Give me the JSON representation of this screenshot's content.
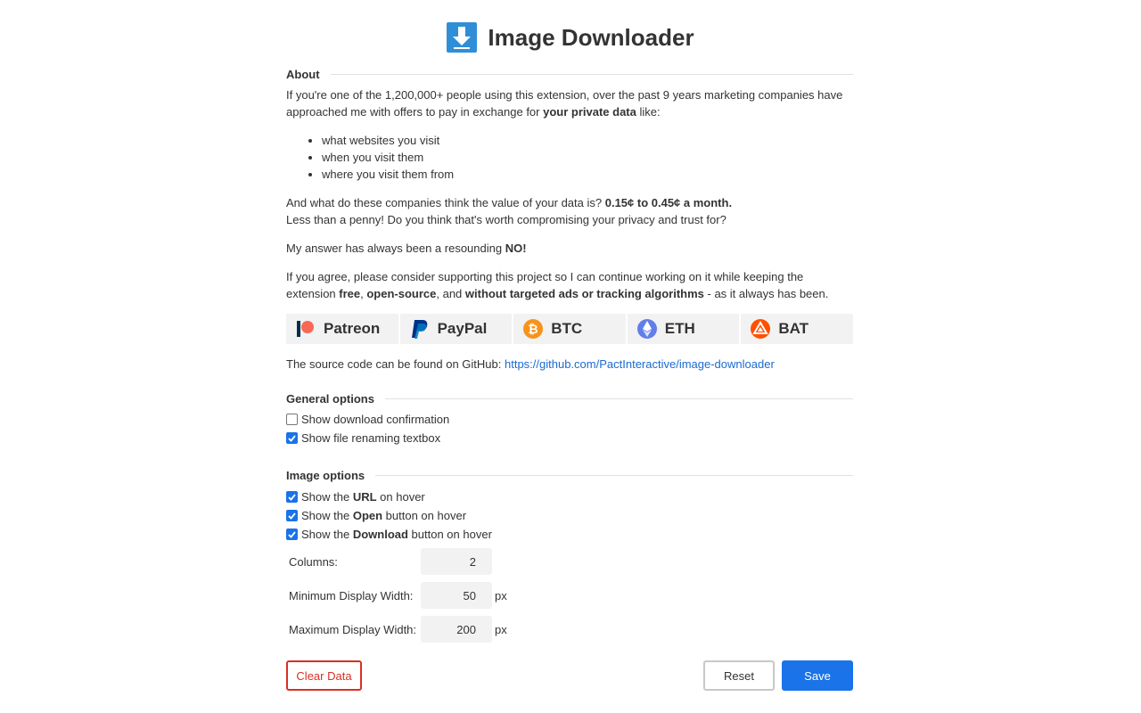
{
  "header": {
    "title": "Image Downloader",
    "logo_icon": "download-arrow-icon"
  },
  "about": {
    "heading": "About",
    "p1_pre": "If you're one of the 1,200,000+ people using this extension, over the past 9 years marketing companies have approached me with offers to pay in exchange for ",
    "p1_bold": "your private data",
    "p1_post": " like:",
    "list": [
      "what websites you visit",
      "when you visit them",
      "where you visit them from"
    ],
    "p2_pre": "And what do these companies think the value of your data is? ",
    "p2_bold": "0.15¢ to 0.45¢ a month.",
    "p2_line2": "Less than a penny! Do you think that's worth compromising your privacy and trust for?",
    "p3_pre": "My answer has always been a resounding ",
    "p3_bold": "NO!",
    "p4_a": "If you agree, please consider supporting this project so I can continue working on it while keeping the extension ",
    "p4_b": "free",
    "p4_c": ", ",
    "p4_d": "open-source",
    "p4_e": ", and ",
    "p4_f": "without targeted ads or tracking algorithms",
    "p4_g": " - as it always has been.",
    "donate": [
      {
        "label": "Patreon",
        "icon": "patreon-icon",
        "color": "#f96854"
      },
      {
        "label": "PayPal",
        "icon": "paypal-icon",
        "color": "#003087"
      },
      {
        "label": "BTC",
        "icon": "bitcoin-icon",
        "color": "#f7931a"
      },
      {
        "label": "ETH",
        "icon": "ethereum-icon",
        "color": "#627eea"
      },
      {
        "label": "BAT",
        "icon": "bat-icon",
        "color": "#ff5000"
      }
    ],
    "source_pre": "The source code can be found on GitHub: ",
    "source_link": "https://github.com/PactInteractive/image-downloader"
  },
  "general": {
    "heading": "General options",
    "options": [
      {
        "label": "Show download confirmation",
        "checked": false
      },
      {
        "label": "Show file renaming textbox",
        "checked": true
      }
    ]
  },
  "image": {
    "heading": "Image options",
    "hover": [
      {
        "pre": "Show the ",
        "bold": "URL",
        "post": " on hover",
        "checked": true
      },
      {
        "pre": "Show the ",
        "bold": "Open",
        "post": " button on hover",
        "checked": true
      },
      {
        "pre": "Show the ",
        "bold": "Download",
        "post": " button on hover",
        "checked": true
      }
    ],
    "columns": {
      "label": "Columns:",
      "value": "2",
      "unit": ""
    },
    "min_width": {
      "label": "Minimum Display Width:",
      "value": "50",
      "unit": "px"
    },
    "max_width": {
      "label": "Maximum Display Width:",
      "value": "200",
      "unit": "px"
    }
  },
  "actions": {
    "clear": "Clear Data",
    "reset": "Reset",
    "save": "Save"
  },
  "colors": {
    "accent": "#1a73e8",
    "danger": "#d93025",
    "link": "#1a6bd0"
  }
}
